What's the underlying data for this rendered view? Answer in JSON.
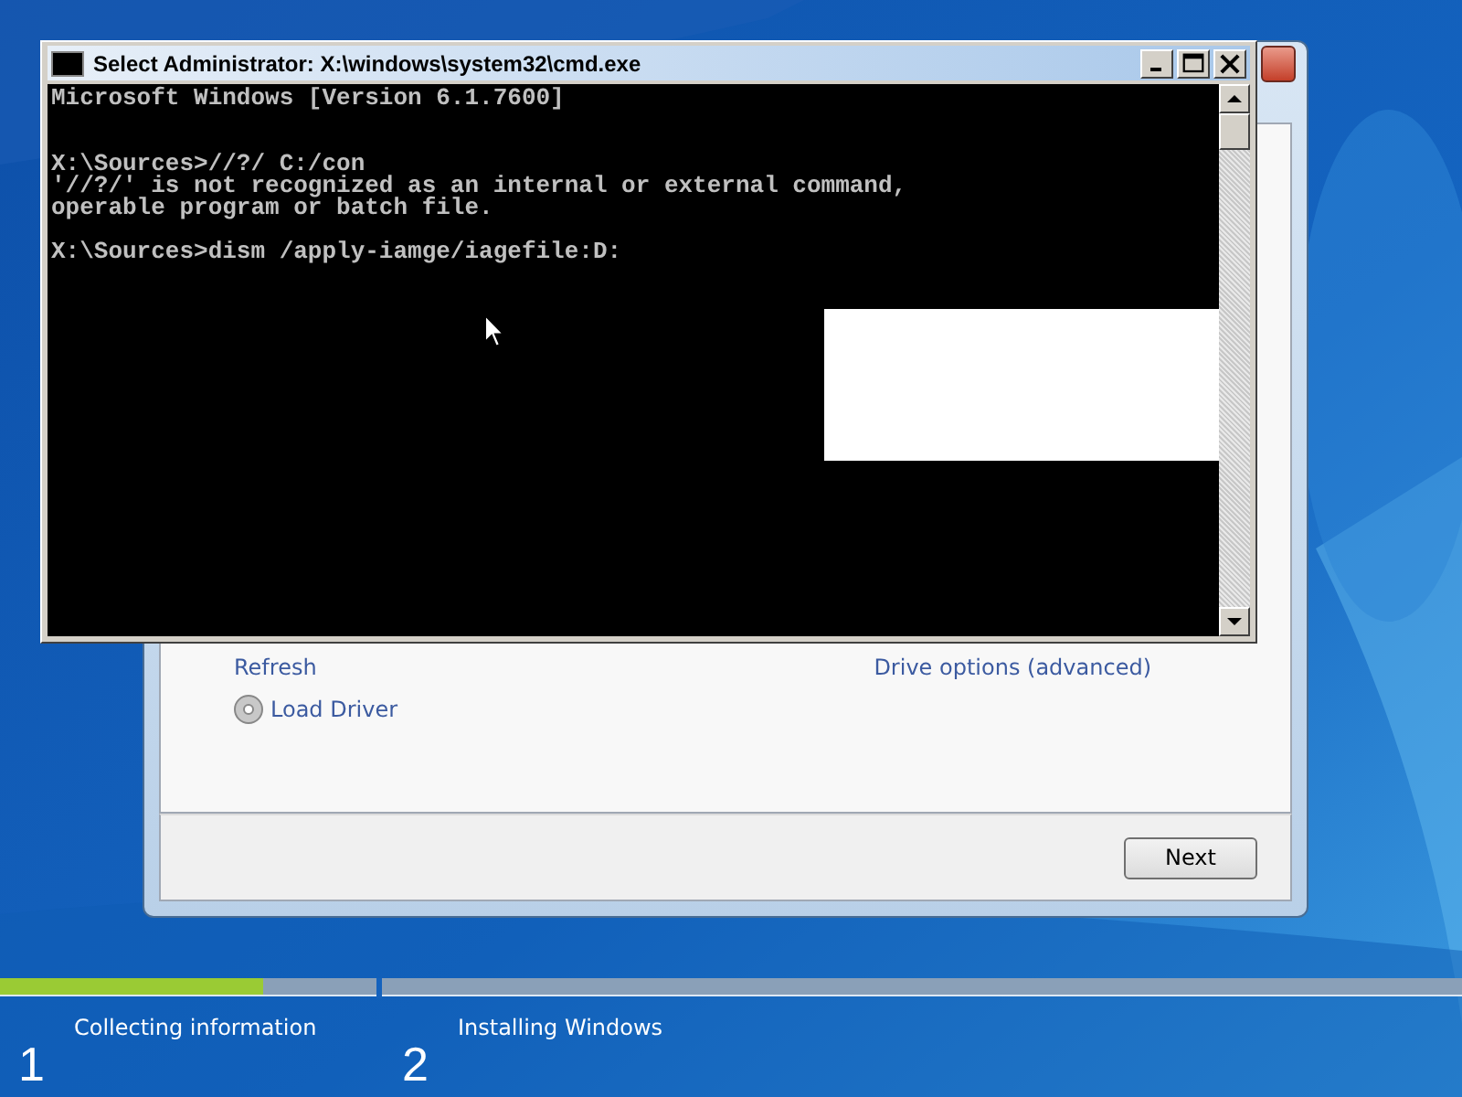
{
  "setup_window": {
    "links": [
      {
        "label": "Refresh"
      },
      {
        "label": "Drive options (advanced)"
      },
      {
        "label": "Load Driver"
      }
    ],
    "next_button": "Next"
  },
  "console_window": {
    "title": "Select Administrator: X:\\windows\\system32\\cmd.exe",
    "blocks": [
      [
        "Microsoft Windows [Version 6.1.7600]"
      ],
      [
        "X:\\Sources>//?/ C:/con",
        "'//?/' is not recognized as an internal or external command,",
        "operable program or batch file."
      ],
      [
        "X:\\Sources>dism /apply-iamge/iagefile:D:"
      ]
    ]
  },
  "progress": {
    "level": 0.18
  },
  "steps": [
    {
      "number": "1",
      "label": "Collecting information"
    },
    {
      "number": "2",
      "label": "Installing Windows"
    }
  ]
}
